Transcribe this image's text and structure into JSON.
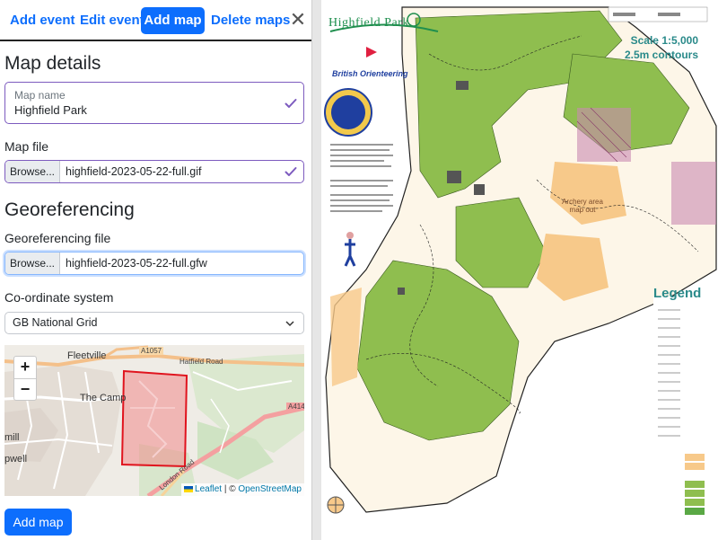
{
  "tabs": [
    {
      "label": "Add event"
    },
    {
      "label": "Edit event"
    },
    {
      "label": "Add map",
      "active": true
    },
    {
      "label": "Delete maps"
    }
  ],
  "close_glyph": "✕",
  "map_details": {
    "heading": "Map details",
    "map_name": {
      "label": "Map name",
      "value": "Highfield Park",
      "valid": true
    },
    "map_file": {
      "label": "Map file",
      "button": "Browse...",
      "filename": "highfield-2023-05-22-full.gif",
      "valid": true
    }
  },
  "georeferencing": {
    "heading": "Georeferencing",
    "file": {
      "label": "Georeferencing file",
      "button": "Browse...",
      "filename": "highfield-2023-05-22-full.gfw"
    },
    "coordinate_system": {
      "label": "Co-ordinate system",
      "selected": "GB National Grid"
    }
  },
  "preview_map": {
    "zoom_in": "+",
    "zoom_out": "−",
    "labels": {
      "fleetville": "Fleetville",
      "the_camp": "The Camp",
      "mill": "mill",
      "pwell": "pwell",
      "a1057": "A1057",
      "a414": "A414",
      "hatfield_road": "Hatfield Road",
      "london_road": "London Road"
    },
    "attribution": {
      "leaflet": "Leaflet",
      "separator": " | © ",
      "osm": "OpenStreetMap"
    },
    "colors": {
      "overlay_fill": "#f08a8a",
      "overlay_stroke": "#e0141e"
    }
  },
  "submit_label": "Add map",
  "orienteering_map": {
    "title": "Highfield Park",
    "organisation": "British Orienteering",
    "scale": "Scale 1:5,000",
    "contours": "2.5m contours",
    "legend_heading": "Legend",
    "note": "Archery area map out"
  },
  "colors": {
    "primary": "#0d6efd",
    "valid": "#7d5bbf",
    "map_green": "#8fbe4f",
    "map_yellow": "#f7c98a"
  }
}
